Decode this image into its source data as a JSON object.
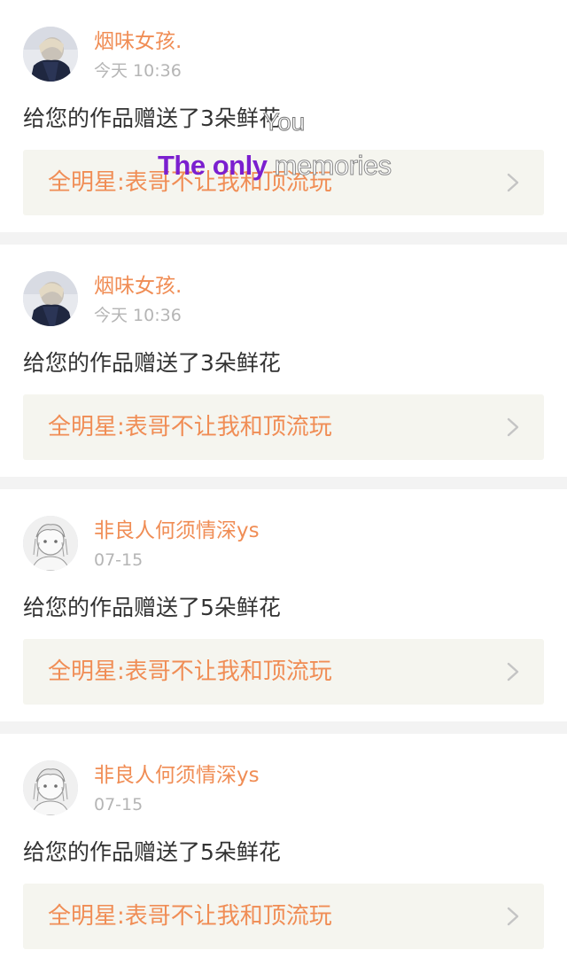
{
  "notifications": [
    {
      "username": "烟味女孩.",
      "time": "今天 10:36",
      "message": "给您的作品赠送了3朵鲜花",
      "work_title": "全明星:表哥不让我和顶流玩",
      "avatar_icon": "dark-avatar-icon"
    },
    {
      "username": "烟味女孩.",
      "time": "今天 10:36",
      "message": "给您的作品赠送了3朵鲜花",
      "work_title": "全明星:表哥不让我和顶流玩",
      "avatar_icon": "dark-avatar-icon"
    },
    {
      "username": "非良人何须情深ys",
      "time": "07-15",
      "message": "给您的作品赠送了5朵鲜花",
      "work_title": "全明星:表哥不让我和顶流玩",
      "avatar_icon": "sketch-avatar-icon"
    },
    {
      "username": "非良人何须情深ys",
      "time": "07-15",
      "message": "给您的作品赠送了5朵鲜花",
      "work_title": "全明星:表哥不让我和顶流玩",
      "avatar_icon": "sketch-avatar-icon"
    }
  ],
  "overlay": {
    "caption_the_only": "The only",
    "caption_memories": " memories",
    "caption_you": "You"
  },
  "colors": {
    "accent": "#f08d55",
    "overlay_purple": "#7b1fcf",
    "card_link_bg": "#f5f5ef",
    "separator": "#f3f3f3"
  }
}
